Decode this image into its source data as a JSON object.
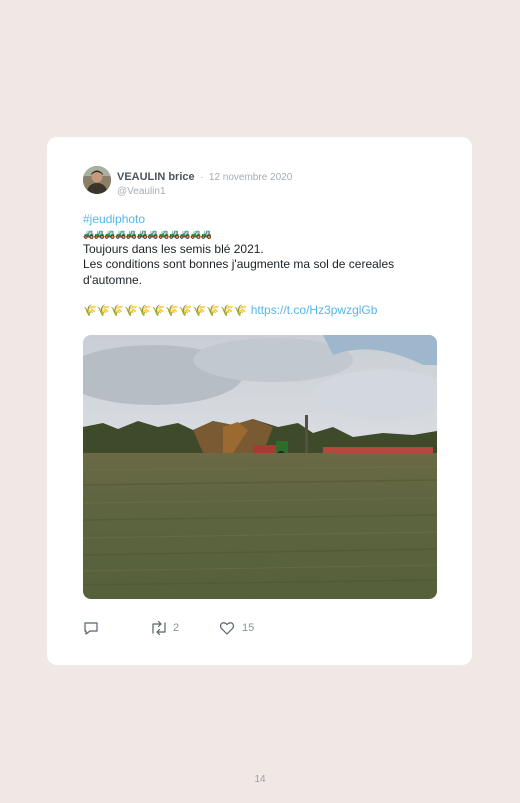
{
  "tweet": {
    "display_name": "VEAULIN brice",
    "separator": "·",
    "date": "12 novembre 2020",
    "handle": "@Veaulin1",
    "hashtag": "#jeudiphoto",
    "tractor_emojis": "🚜🚜🚜🚜🚜🚜🚜🚜🚜🚜🚜🚜",
    "line1": "Toujours dans les semis blé 2021.",
    "line2": "Les conditions sont bonnes j'augmente ma sol de cereales d'automne.",
    "wheat_emojis": "🌾🌾🌾🌾🌾🌾🌾🌾🌾🌾🌾🌾",
    "link": "https://t.co/Hz3pwzglGb",
    "actions": {
      "reply_icon": "reply-icon",
      "retweet_icon": "retweet-icon",
      "retweet_count": "2",
      "like_icon": "heart-icon",
      "like_count": "15"
    }
  },
  "page_number": "14"
}
